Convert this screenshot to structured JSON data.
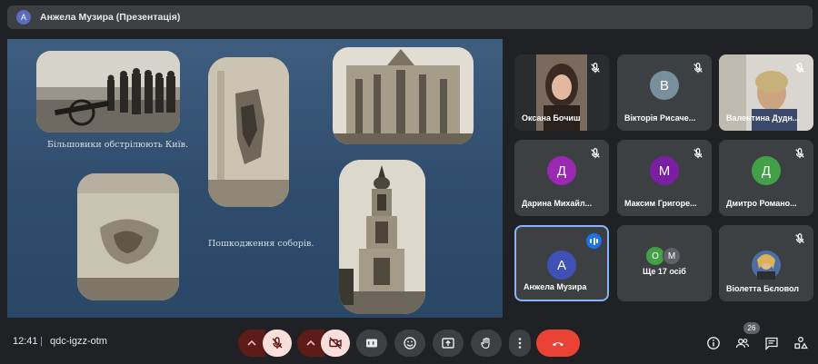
{
  "header": {
    "avatar_letter": "А",
    "title": "Анжела Музира (Презентація)"
  },
  "slide": {
    "caption_1": "Більшовики обстрілюють Київ.",
    "caption_2": "Пошкодження соборів."
  },
  "participants": [
    {
      "name": "Оксана Бочиш",
      "type": "video",
      "muted": true
    },
    {
      "name": "Вікторія Рисаче...",
      "initial": "В",
      "color": "#78909c",
      "muted": true
    },
    {
      "name": "Валентина Дудн...",
      "type": "video",
      "muted": true
    },
    {
      "name": "Дарина Михайл...",
      "initial": "Д",
      "color": "#9c27b0",
      "muted": true
    },
    {
      "name": "Максим Григоре...",
      "initial": "М",
      "color": "#7b1fa2",
      "muted": true
    },
    {
      "name": "Дмитро Романо...",
      "initial": "Д",
      "color": "#43a047",
      "muted": true
    },
    {
      "name": "Анжела Музира",
      "initial": "А",
      "color": "#3f51b5",
      "muted": false,
      "speaking": true
    },
    {
      "name": "Ще 17 осіб",
      "more_initials": [
        "О",
        "М"
      ],
      "more_colors": [
        "#43a047",
        "#5f6368"
      ]
    },
    {
      "name": "Віолетта Бєловол",
      "type": "photo",
      "muted": true
    }
  ],
  "bottom_bar": {
    "time": "12:41",
    "separator": "|",
    "meeting_code": "qdc-igzz-otm",
    "participant_count": "26",
    "icons": [
      "mic-off-icon",
      "camera-off-icon",
      "captions-icon",
      "emoji-icon",
      "present-icon",
      "raise-hand-icon",
      "more-options-icon",
      "end-call-icon",
      "info-icon",
      "people-icon",
      "chat-icon",
      "activities-icon"
    ]
  },
  "colors": {
    "end_call": "#ea4335",
    "muted_btn": "#f9dedc",
    "accent": "#8ab4f8"
  }
}
